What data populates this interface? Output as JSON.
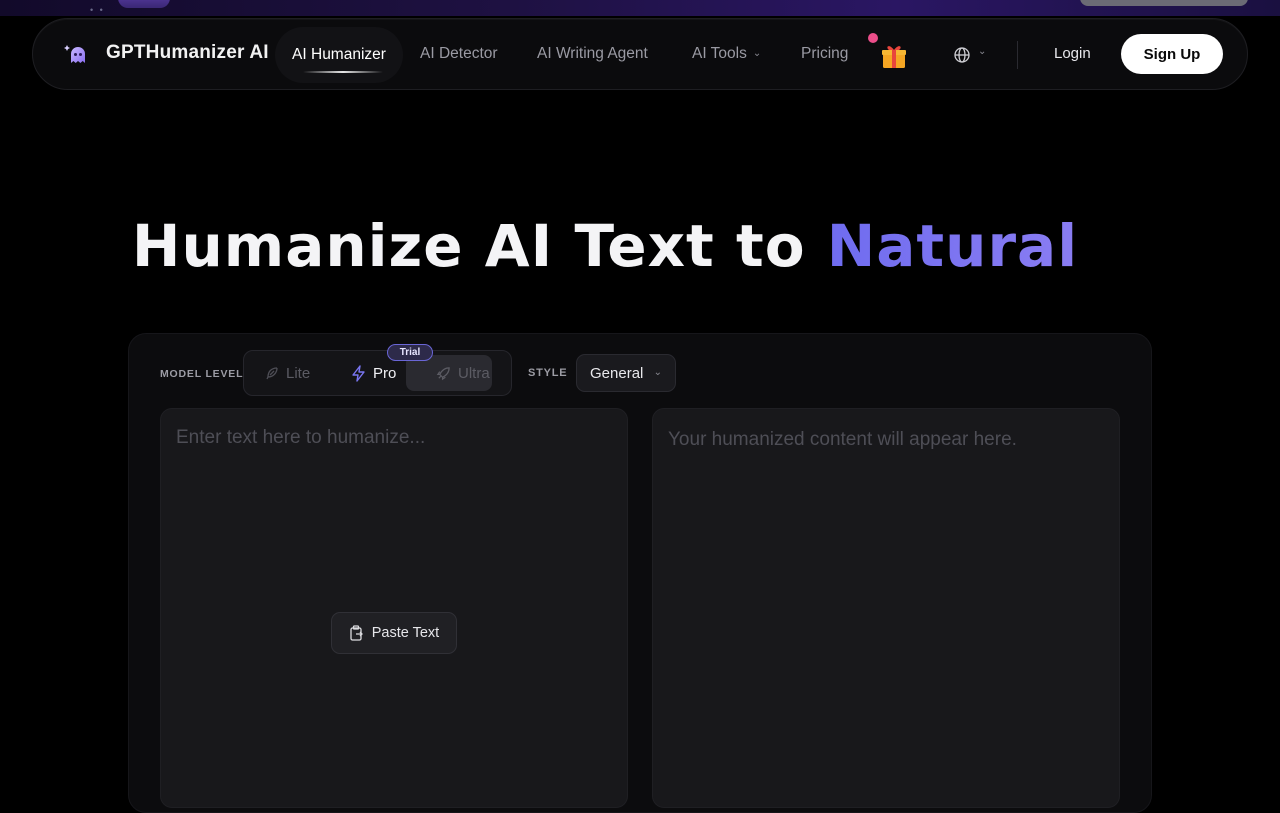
{
  "brand": {
    "name": "GPTHumanizer AI"
  },
  "nav": {
    "items": [
      {
        "label": "AI Humanizer"
      },
      {
        "label": "AI Detector"
      },
      {
        "label": "AI Writing Agent"
      },
      {
        "label": "AI Tools"
      },
      {
        "label": "Pricing"
      }
    ],
    "login": "Login",
    "signup": "Sign Up"
  },
  "hero": {
    "title_main": "Humanize AI Text to ",
    "title_accent": "Natural"
  },
  "model": {
    "label": "MODEL LEVEL",
    "options": [
      "Lite",
      "Pro",
      "Ultra"
    ],
    "selected": "Pro",
    "trial_badge": "Trial"
  },
  "style": {
    "label": "STYLE",
    "value": "General"
  },
  "editor": {
    "input_placeholder": "Enter text here to humanize...",
    "output_placeholder": "Your humanized content will appear here.",
    "paste_label": "Paste Text"
  },
  "icons": {
    "logo": "ghost-logo-icon",
    "gift": "gift-icon",
    "globe": "globe-icon",
    "lite": "feather-icon",
    "pro": "lightning-icon",
    "ultra": "rocket-icon",
    "paste": "clipboard-icon"
  },
  "colors": {
    "accent": "#6f6cf0",
    "background": "#000000",
    "notification": "#ec4e8a"
  }
}
